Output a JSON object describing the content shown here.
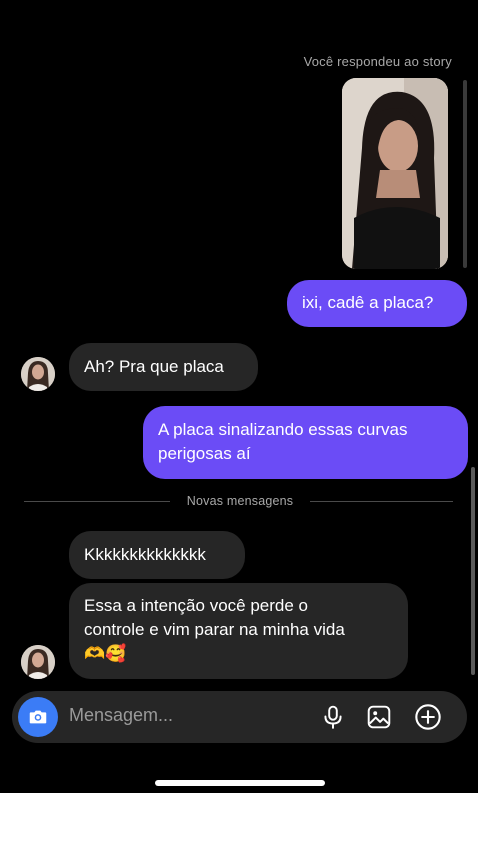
{
  "story": {
    "caption": "Você respondeu ao story"
  },
  "messages": [
    {
      "from": "me",
      "text": "ixi, cadê a placa?"
    },
    {
      "from": "them",
      "text": "Ah? Pra que placa"
    },
    {
      "from": "me",
      "line1": "A placa sinalizando essas curvas",
      "line2": "perigosas aí"
    },
    {
      "from": "them",
      "text": "Kkkkkkkkkkkkkk"
    },
    {
      "from": "them",
      "line1": "Essa a intenção você perde o",
      "line2": "controle e vim parar na minha vida",
      "line3": "🫶🥰"
    }
  ],
  "divider": {
    "label": "Novas mensagens"
  },
  "composer": {
    "placeholder": "Mensagem...",
    "icons": [
      "camera-icon",
      "microphone-icon",
      "image-icon",
      "plus-circle-icon"
    ]
  },
  "colors": {
    "background": "#000000",
    "outgoing_bubble": "#6b4cf6",
    "incoming_bubble": "#262626",
    "camera_button": "#3b7cf6"
  }
}
